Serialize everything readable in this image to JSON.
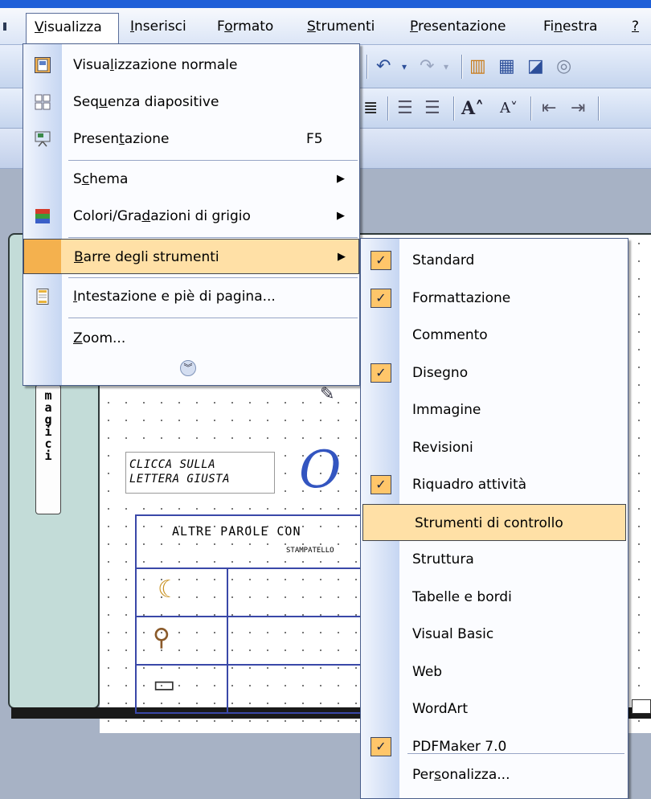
{
  "menubar": {
    "items": [
      {
        "label": "Visualizza",
        "mnemonic": "V",
        "rest": "isualizza"
      },
      {
        "label": "Inserisci",
        "mnemonic": "I",
        "rest": "nserisci"
      },
      {
        "label": "Formato",
        "pre": "F",
        "mnemonic": "o",
        "rest": "rmato"
      },
      {
        "label": "Strumenti",
        "mnemonic": "S",
        "rest": "trumenti"
      },
      {
        "label": "Presentazione",
        "mnemonic": "P",
        "rest": "resentazione"
      },
      {
        "label": "Finestra",
        "pre": "Fi",
        "mnemonic": "n",
        "rest": "estra"
      },
      {
        "label": "?"
      }
    ]
  },
  "view_menu": {
    "items": [
      {
        "label": "Visualizzazione normale",
        "pre": "Visua",
        "mnemonic": "l",
        "rest": "izzazione normale",
        "icon": "normal-view-icon"
      },
      {
        "label": "Sequenza diapositive",
        "pre": "Seq",
        "mnemonic": "u",
        "rest": "enza diapositive",
        "icon": "slide-sorter-icon"
      },
      {
        "label": "Presentazione",
        "pre": "Presen",
        "mnemonic": "t",
        "rest": "azione",
        "shortcut": "F5",
        "icon": "slideshow-icon"
      },
      {
        "label": "Schema",
        "pre": "S",
        "mnemonic": "c",
        "rest": "hema",
        "submenu": true
      },
      {
        "label": "Colori/Gradazioni di grigio",
        "pre": "Colori/Gra",
        "mnemonic": "d",
        "rest": "azioni di grigio",
        "submenu": true,
        "icon": "color-grayscale-icon"
      },
      {
        "label": "Barre degli strumenti",
        "pre": "",
        "mnemonic": "B",
        "rest": "arre degli strumenti",
        "submenu": true,
        "highlighted": true
      },
      {
        "label": "Intestazione e piè di pagina...",
        "pre": "",
        "mnemonic": "I",
        "rest": "ntestazione e piè di pagina...",
        "icon": "header-footer-icon"
      },
      {
        "label": "Zoom...",
        "pre": "",
        "mnemonic": "Z",
        "rest": "oom..."
      }
    ],
    "expand_icon": "chevron-double-down-icon"
  },
  "toolbars_submenu": {
    "items": [
      {
        "label": "Standard",
        "checked": true
      },
      {
        "label": "Formattazione",
        "checked": true
      },
      {
        "label": "Commento",
        "checked": false
      },
      {
        "label": "Disegno",
        "checked": true
      },
      {
        "label": "Immagine",
        "checked": false
      },
      {
        "label": "Revisioni",
        "checked": false
      },
      {
        "label": "Riquadro attività",
        "checked": true
      },
      {
        "label": "Strumenti di controllo",
        "checked": false,
        "highlighted": true
      },
      {
        "label": "Struttura",
        "checked": false
      },
      {
        "label": "Tabelle e bordi",
        "checked": false
      },
      {
        "label": "Visual Basic",
        "checked": false
      },
      {
        "label": "Web",
        "checked": false
      },
      {
        "label": "WordArt",
        "checked": false
      },
      {
        "label": "PDFMaker 7.0",
        "checked": true
      },
      {
        "label": "Personalizza...",
        "pre": "Per",
        "mnemonic": "s",
        "rest": "onalizza..."
      }
    ],
    "check_glyph": "✓"
  },
  "slide": {
    "tab_text": "magici",
    "clicca_line1": "CLICCA SULLA",
    "clicca_line2": "LETTERA GIUSTA",
    "big_letter": "O",
    "table_title": "ALTRE PAROLE CON",
    "table_sub": "STAMPATELLO"
  },
  "colors": {
    "menu_highlight": "#ffe0a6",
    "check_bg": "#ffc66a",
    "menubar_blue": "#1f5fd8"
  }
}
